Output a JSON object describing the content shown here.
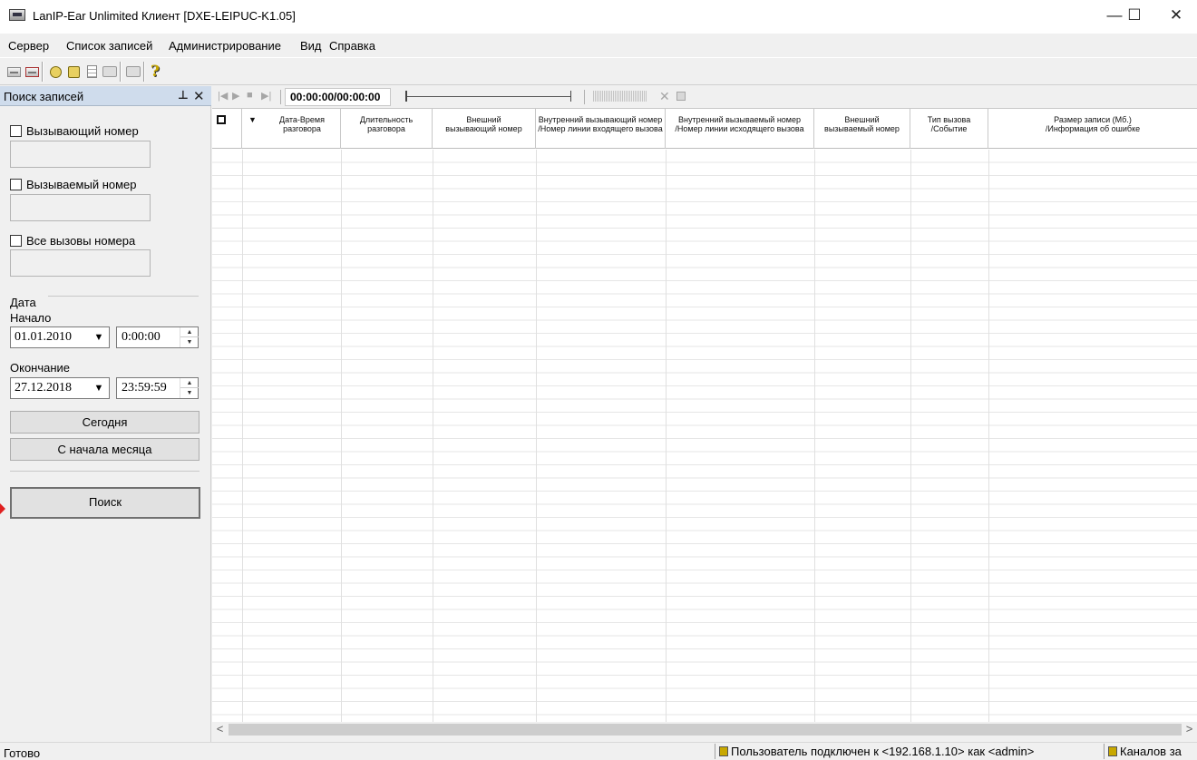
{
  "window": {
    "title": "LanIP-Ear Unlimited Клиент [DXE-LEIPUC-K1.05]",
    "minimize": "—",
    "maximize": "☐",
    "close": "✕"
  },
  "menu": [
    "Сервер",
    "Список записей",
    "Администрирование",
    "Вид",
    "Справка"
  ],
  "toolbar": {
    "icons": [
      "connect-icon",
      "disconnect-icon",
      "users-icon",
      "lock-icon",
      "document-icon",
      "image-icon",
      "print-icon",
      "help-icon"
    ],
    "help_glyph": "?"
  },
  "search_panel": {
    "title": "Поиск записей",
    "pin_glyph": "⊥",
    "close_glyph": "✕",
    "caller_label": "Вызывающий номер",
    "caller_value": "",
    "called_label": "Вызываемый номер",
    "called_value": "",
    "all_calls_label": "Все вызовы номера",
    "all_calls_value": "",
    "date_section": "Дата",
    "start_label": "Начало",
    "start_date": "01.01.2010",
    "start_time": "0:00:00",
    "end_label": "Окончание",
    "end_date": "27.12.2018",
    "end_time": "23:59:59",
    "today_button": "Сегодня",
    "month_button": "С начала месяца",
    "search_button": "Поиск",
    "dropdown_glyph": "▼",
    "spin_up": "▲",
    "spin_down": "▼"
  },
  "player": {
    "first": "|◀",
    "play": "▶",
    "stop": "■",
    "last": "▶|",
    "time": "00:00:00/00:00:00",
    "close_glyph": "✕"
  },
  "grid": {
    "sort_glyph": "▼",
    "columns": [
      [
        "Дата-Время",
        "разговора"
      ],
      [
        "Длительность",
        "разговора"
      ],
      [
        "Внешний",
        "вызывающий номер"
      ],
      [
        "Внутренний вызывающий номер",
        "/Номер линии входящего вызова"
      ],
      [
        "Внутренний вызываемый номер",
        "/Номер линии исходящего вызова"
      ],
      [
        "Внешний",
        "вызываемый номер"
      ],
      [
        "Тип вызова",
        "/Событие"
      ],
      [
        "Размер записи (Мб.)",
        "/Информация об ошибке"
      ]
    ]
  },
  "scroll": {
    "left": "<",
    "right": ">"
  },
  "status": {
    "ready": "Готово",
    "connection": "Пользователь подключен к <192.168.1.10> как <admin>",
    "channels": "Каналов за"
  }
}
